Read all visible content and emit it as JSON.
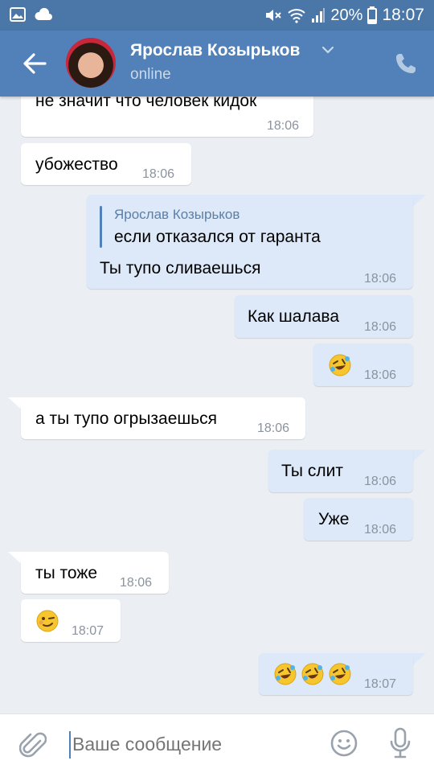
{
  "status_bar": {
    "battery": "20%",
    "time": "18:07"
  },
  "header": {
    "contact_name": "Ярослав Козырьков",
    "presence": "online"
  },
  "messages": [
    {
      "dir": "in",
      "text": "не значит что человек кидок",
      "time": "18:06"
    },
    {
      "dir": "in",
      "text": "убожество",
      "time": "18:06"
    },
    {
      "dir": "out",
      "reply_to_name": "Ярослав Козырьков",
      "reply_to_text": "если отказался от гаранта",
      "text": "Ты тупо сливаешься",
      "time": "18:06"
    },
    {
      "dir": "out",
      "text": "Как шалава",
      "time": "18:06"
    },
    {
      "dir": "out",
      "emoji": [
        "rolling-on-floor-laughing"
      ],
      "time": "18:06"
    },
    {
      "dir": "in",
      "text": "а ты тупо огрызаешься",
      "time": "18:06"
    },
    {
      "dir": "out",
      "text": "Ты слит",
      "time": "18:06"
    },
    {
      "dir": "out",
      "text": "Уже",
      "time": "18:06"
    },
    {
      "dir": "in",
      "text": "ты тоже",
      "time": "18:06"
    },
    {
      "dir": "in",
      "emoji": [
        "winking-face"
      ],
      "time": "18:07"
    },
    {
      "dir": "out",
      "emoji": [
        "rolling-on-floor-laughing",
        "rolling-on-floor-laughing",
        "rolling-on-floor-laughing"
      ],
      "time": "18:07"
    }
  ],
  "composer": {
    "placeholder": "Ваше сообщение"
  },
  "colors": {
    "header": "#5181b8",
    "statusbar": "#4a76a8",
    "outgoing": "#dde9f8",
    "background": "#ebeef3"
  }
}
